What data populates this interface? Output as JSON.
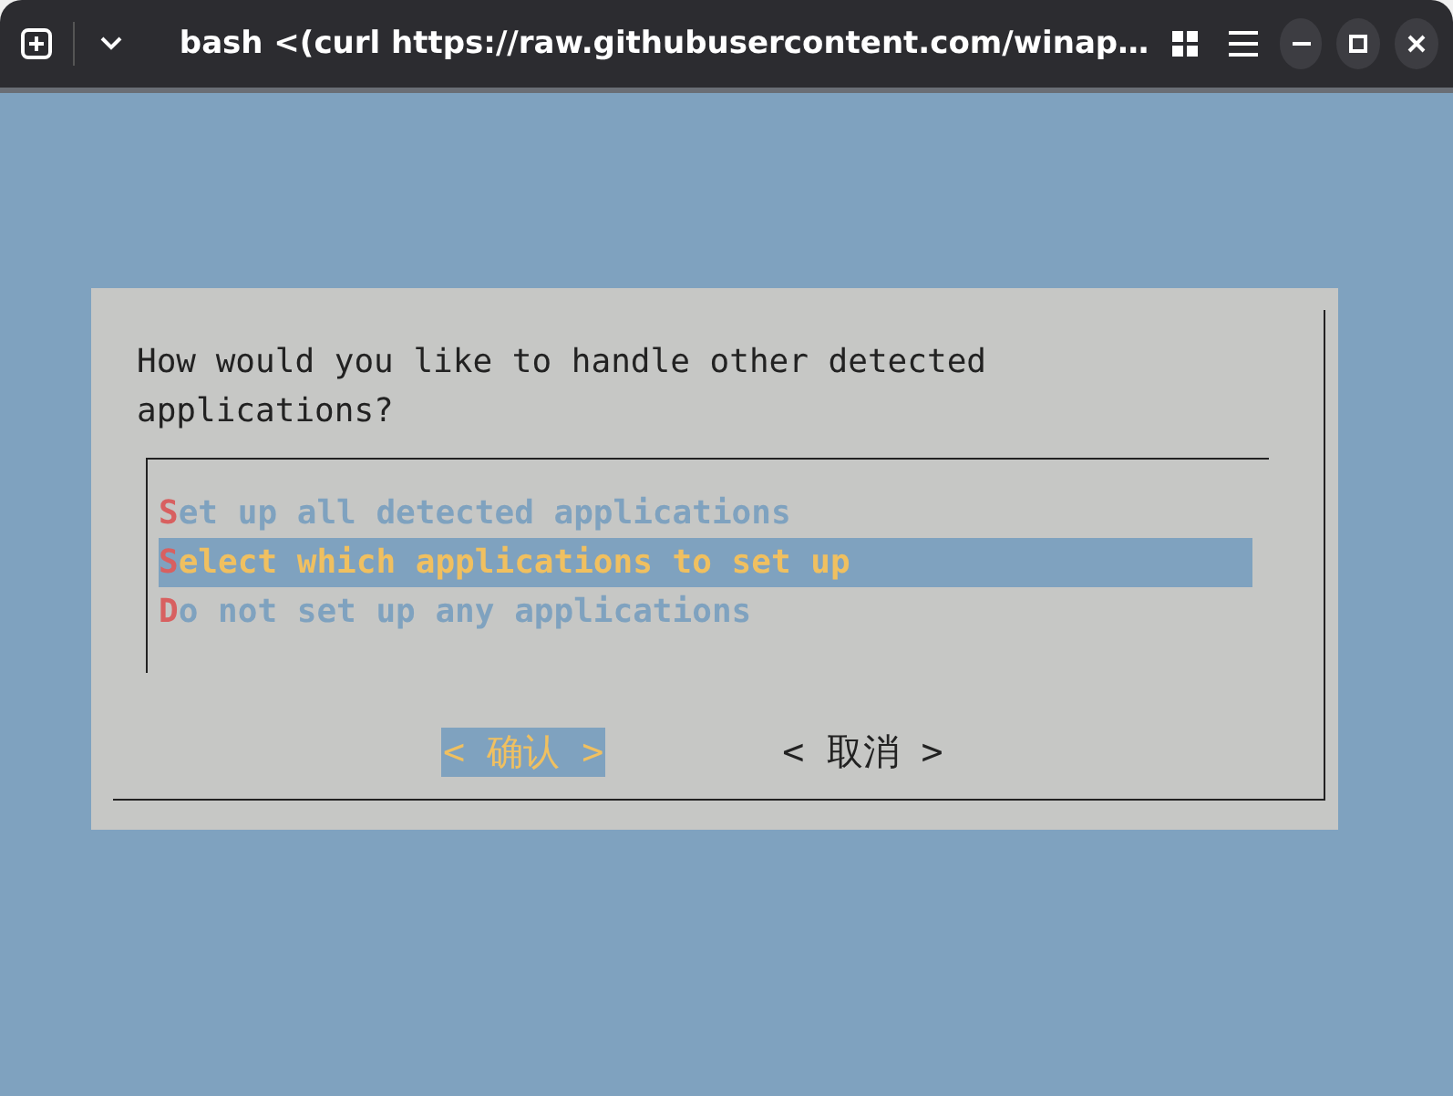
{
  "window": {
    "title": "bash <(curl https://raw.githubusercontent.com/winap…"
  },
  "dialog": {
    "prompt": "How would you like to handle other detected applications?",
    "options": [
      {
        "label": "Set up all detected applications",
        "selected": false
      },
      {
        "label": "Select which applications to set up",
        "selected": true
      },
      {
        "label": "Do not set up any applications",
        "selected": false
      }
    ],
    "buttons": [
      {
        "label": "< 确认 >",
        "selected": true
      },
      {
        "label": "< 取消 >",
        "selected": false
      }
    ]
  }
}
